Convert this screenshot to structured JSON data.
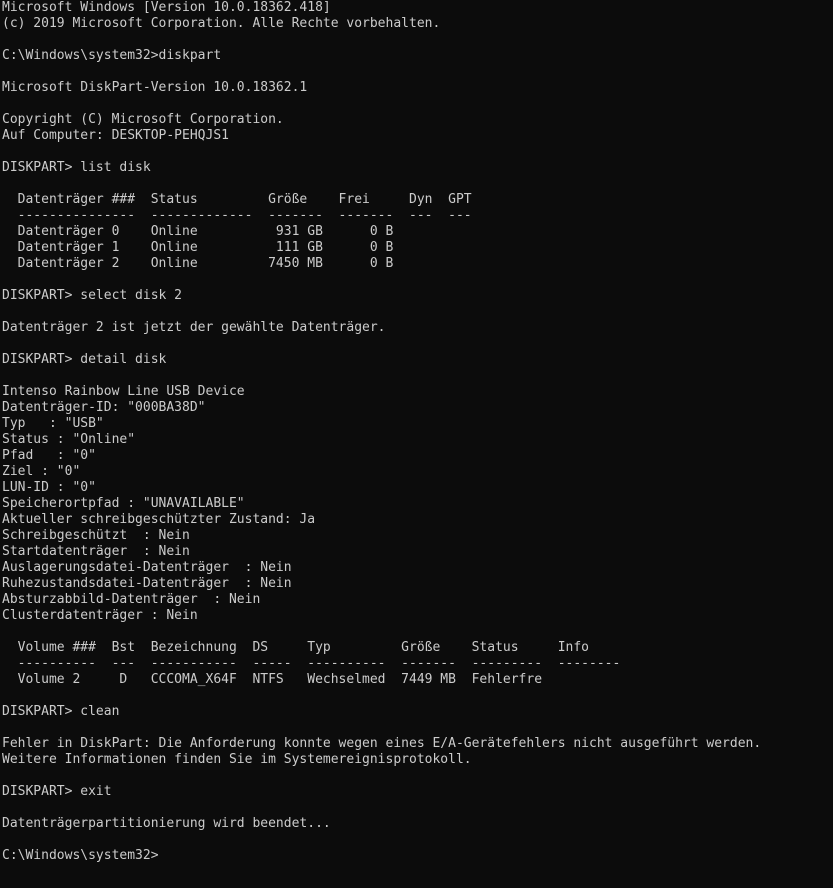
{
  "window": {
    "type": "console",
    "background": "#0c0c0c",
    "foreground": "#cccccc"
  },
  "lines": [
    {
      "row": 0,
      "text": "Microsoft Windows [Version 10.0.18362.418]"
    },
    {
      "row": 1,
      "text": "(c) 2019 Microsoft Corporation. Alle Rechte vorbehalten."
    },
    {
      "row": 3,
      "text": "C:\\Windows\\system32>diskpart"
    },
    {
      "row": 5,
      "text": "Microsoft DiskPart-Version 10.0.18362.1"
    },
    {
      "row": 7,
      "text": "Copyright (C) Microsoft Corporation."
    },
    {
      "row": 8,
      "text": "Auf Computer: DESKTOP-PEHQJS1"
    },
    {
      "row": 10,
      "text": "DISKPART> list disk"
    },
    {
      "row": 12,
      "text": "  Datenträger ###  Status         Größe    Frei     Dyn  GPT"
    },
    {
      "row": 13,
      "text": "  ---------------  -------------  -------  -------  ---  ---"
    },
    {
      "row": 14,
      "text": "  Datenträger 0    Online          931 GB      0 B"
    },
    {
      "row": 15,
      "text": "  Datenträger 1    Online          111 GB      0 B"
    },
    {
      "row": 16,
      "text": "  Datenträger 2    Online         7450 MB      0 B"
    },
    {
      "row": 18,
      "text": "DISKPART> select disk 2"
    },
    {
      "row": 20,
      "text": "Datenträger 2 ist jetzt der gewählte Datenträger."
    },
    {
      "row": 22,
      "text": "DISKPART> detail disk"
    },
    {
      "row": 24,
      "text": "Intenso Rainbow Line USB Device"
    },
    {
      "row": 25,
      "text": "Datenträger-ID: \"000BA38D\""
    },
    {
      "row": 26,
      "text": "Typ   : \"USB\""
    },
    {
      "row": 27,
      "text": "Status : \"Online\""
    },
    {
      "row": 28,
      "text": "Pfad   : \"0\""
    },
    {
      "row": 29,
      "text": "Ziel : \"0\""
    },
    {
      "row": 30,
      "text": "LUN-ID : \"0\""
    },
    {
      "row": 31,
      "text": "Speicherortpfad : \"UNAVAILABLE\""
    },
    {
      "row": 32,
      "text": "Aktueller schreibgeschützter Zustand: Ja"
    },
    {
      "row": 33,
      "text": "Schreibgeschützt  : Nein"
    },
    {
      "row": 34,
      "text": "Startdatenträger  : Nein"
    },
    {
      "row": 35,
      "text": "Auslagerungsdatei-Datenträger  : Nein"
    },
    {
      "row": 36,
      "text": "Ruhezustandsdatei-Datenträger  : Nein"
    },
    {
      "row": 37,
      "text": "Absturzabbild-Datenträger  : Nein"
    },
    {
      "row": 38,
      "text": "Clusterdatenträger : Nein"
    },
    {
      "row": 40,
      "text": "  Volume ###  Bst  Bezeichnung  DS     Typ         Größe    Status     Info"
    },
    {
      "row": 41,
      "text": "  ----------  ---  -----------  -----  ----------  -------  ---------  --------"
    },
    {
      "row": 42,
      "text": "  Volume 2     D   CCCOMA_X64F  NTFS   Wechselmed  7449 MB  Fehlerfre"
    },
    {
      "row": 44,
      "text": "DISKPART> clean"
    },
    {
      "row": 46,
      "text": "Fehler in DiskPart: Die Anforderung konnte wegen eines E/A-Gerätefehlers nicht ausgeführt werden."
    },
    {
      "row": 47,
      "text": "Weitere Informationen finden Sie im Systemereignisprotokoll."
    },
    {
      "row": 49,
      "text": "DISKPART> exit"
    },
    {
      "row": 51,
      "text": "Datenträgerpartitionierung wird beendet..."
    },
    {
      "row": 53,
      "text": "C:\\Windows\\system32>"
    }
  ]
}
